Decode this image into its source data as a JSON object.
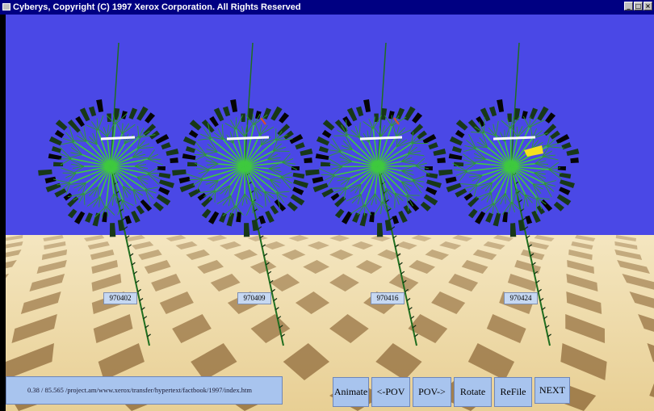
{
  "window": {
    "title": "Cyberys, Copyright (C) 1997 Xerox Corporation. All Rights Reserved"
  },
  "trees": [
    {
      "label": "970402"
    },
    {
      "label": "970409"
    },
    {
      "label": "970416"
    },
    {
      "label": "970424"
    }
  ],
  "status": {
    "url": "0.38 / 85.565 /project.am/www.xerox/transfer/hypertext/factbook/1997/index.htm"
  },
  "buttons": {
    "animate": "Animate",
    "pov_back": "<-POV",
    "pov_forward": "POV->",
    "rotate": "Rotate",
    "refile": "ReFile",
    "next": "NEXT"
  },
  "colors": {
    "sky": "#4a48e6",
    "floor_light": "#f0dcaa",
    "floor_dark": "#8a6434",
    "tree_green": "#3ec93e",
    "tree_dark": "#0c2a0c",
    "panel": "#a8c4ee"
  }
}
